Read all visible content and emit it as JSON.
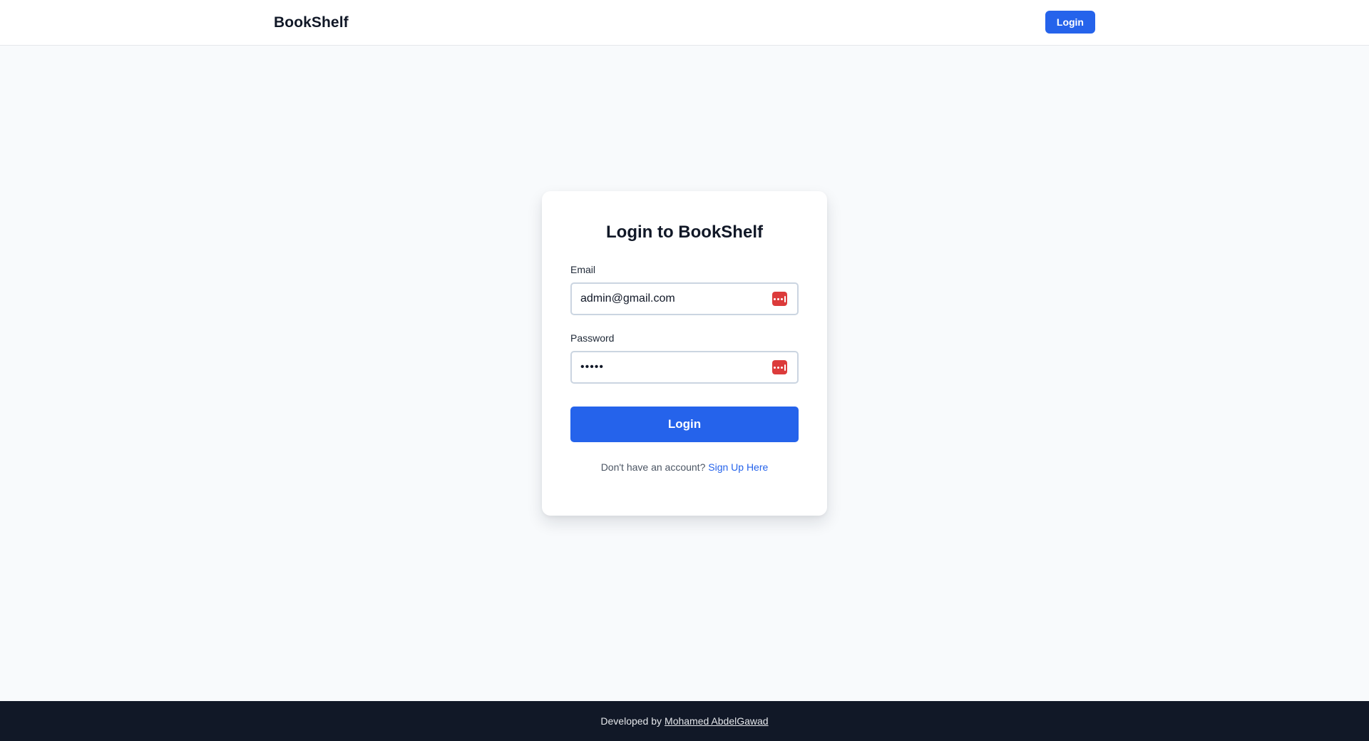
{
  "header": {
    "brand": "BookShelf",
    "login_label": "Login"
  },
  "login_form": {
    "title": "Login to BookShelf",
    "email": {
      "label": "Email",
      "value": "admin@gmail.com",
      "icon": "password-manager-icon"
    },
    "password": {
      "label": "Password",
      "value": "•••••",
      "icon": "password-manager-icon"
    },
    "submit_label": "Login",
    "signup_prompt": "Don't have an account?",
    "signup_link": "Sign Up Here"
  },
  "footer": {
    "prefix": "Developed by",
    "author": "Mohamed AbdelGawad"
  },
  "colors": {
    "primary": "#2563eb",
    "footer_bg": "#111827",
    "page_bg": "#f8fafc",
    "password_manager_icon": "#dc3b3b"
  }
}
